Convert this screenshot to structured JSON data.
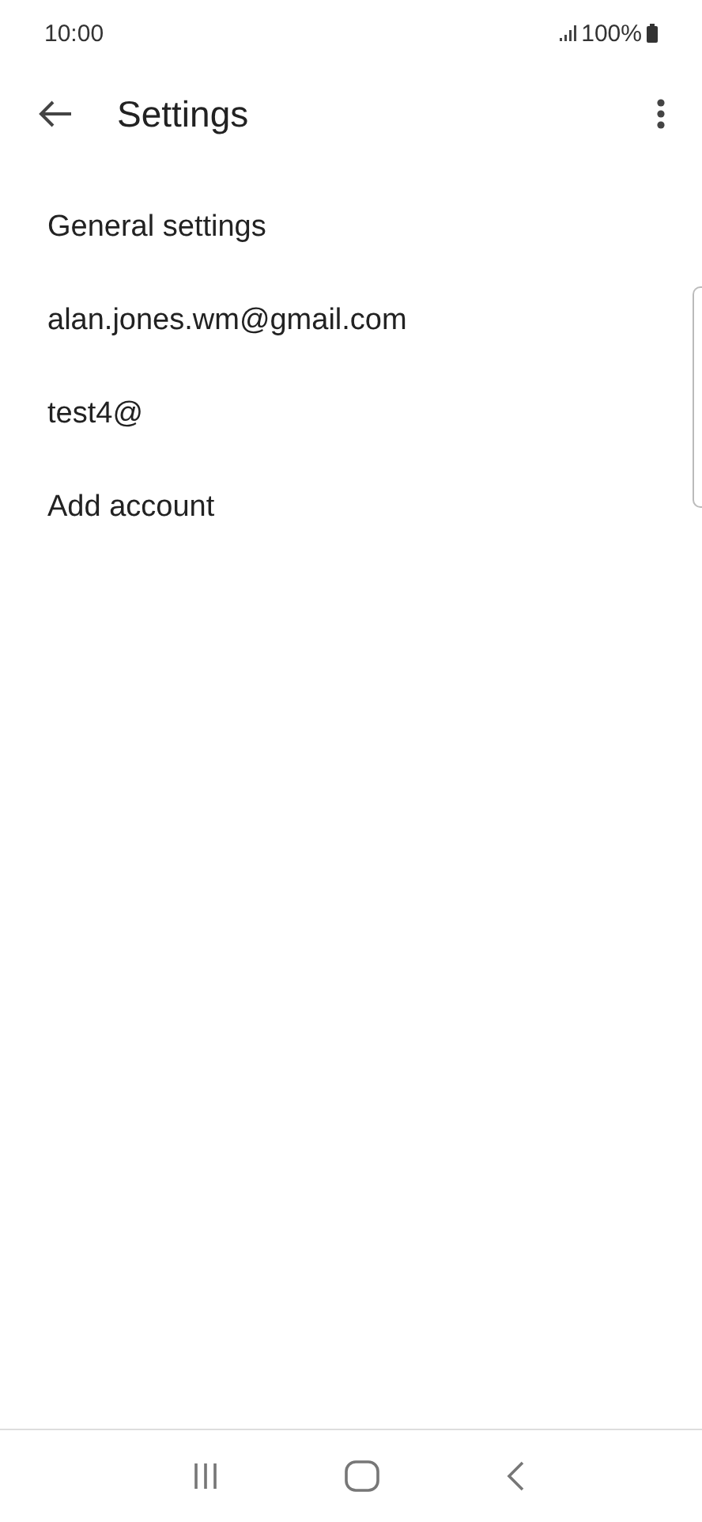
{
  "status_bar": {
    "time": "10:00",
    "battery": "100%"
  },
  "app_bar": {
    "title": "Settings"
  },
  "items": [
    {
      "label": "General settings"
    },
    {
      "label": "alan.jones.wm@gmail.com"
    },
    {
      "label": "test4@"
    },
    {
      "label": "Add account"
    }
  ]
}
